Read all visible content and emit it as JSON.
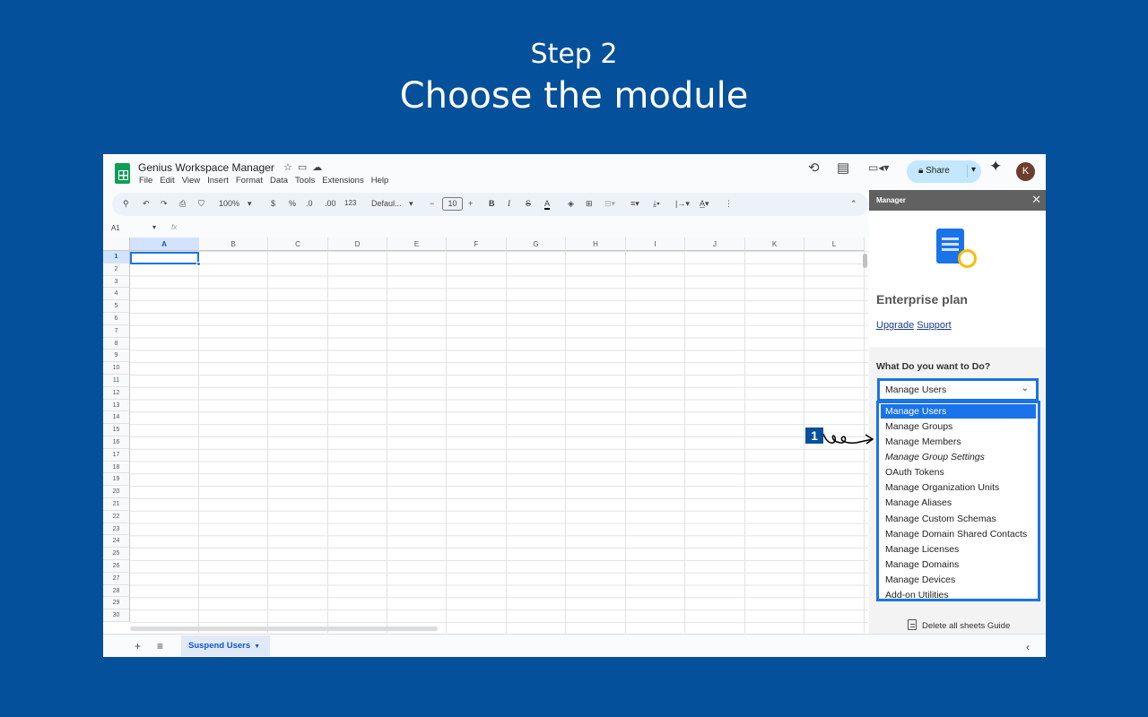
{
  "slide": {
    "step": "Step 2",
    "title": "Choose the module"
  },
  "app": {
    "doc_title": "Genius Workspace Manager",
    "menu": [
      "File",
      "Edit",
      "View",
      "Insert",
      "Format",
      "Data",
      "Tools",
      "Extensions",
      "Help"
    ],
    "share_label": "Share",
    "avatar_initial": "K"
  },
  "toolbar": {
    "zoom": "100%",
    "currency": "$",
    "percent": "%",
    "dec_decrease": ".0",
    "dec_increase": ".00",
    "number_format": "123",
    "font": "Defaul...",
    "font_size": "10",
    "bold": "B",
    "italic": "I",
    "text_color": "A"
  },
  "formula_bar": {
    "cell_ref": "A1",
    "fx": "fx"
  },
  "grid": {
    "columns": [
      "A",
      "B",
      "C",
      "D",
      "E",
      "F",
      "G",
      "H",
      "I",
      "J",
      "K",
      "L"
    ],
    "rows": [
      "1",
      "2",
      "3",
      "4",
      "5",
      "6",
      "7",
      "8",
      "9",
      "10",
      "11",
      "12",
      "13",
      "14",
      "15",
      "16",
      "17",
      "18",
      "19",
      "20",
      "21",
      "22",
      "23",
      "24",
      "25",
      "26",
      "27",
      "28",
      "29",
      "30"
    ],
    "selected_cell": "A1"
  },
  "sheet_tabs": {
    "active": "Suspend Users"
  },
  "panel": {
    "header": "Manager",
    "plan": "Enterprise plan",
    "upgrade_link": "Upgrade",
    "support_link": "Support",
    "question": "What Do you want to Do?",
    "selected": "Manage Users",
    "options": [
      "Manage Users",
      "Manage Groups",
      "Manage Members",
      "Manage Group Settings",
      "OAuth Tokens",
      "Manage Organization Units",
      "Manage Aliases",
      "Manage Custom Schemas",
      "Manage Domain Shared Contacts",
      "Manage Licenses",
      "Manage Domains",
      "Manage Devices",
      "Add-on Utilities"
    ],
    "guide": "Delete all sheets Guide"
  },
  "callout": {
    "number": "1"
  },
  "colors": {
    "background": "#05509b",
    "accent": "#1a73e8",
    "share_button": "#c2e7ff",
    "sheets_green": "#0f9d58"
  }
}
